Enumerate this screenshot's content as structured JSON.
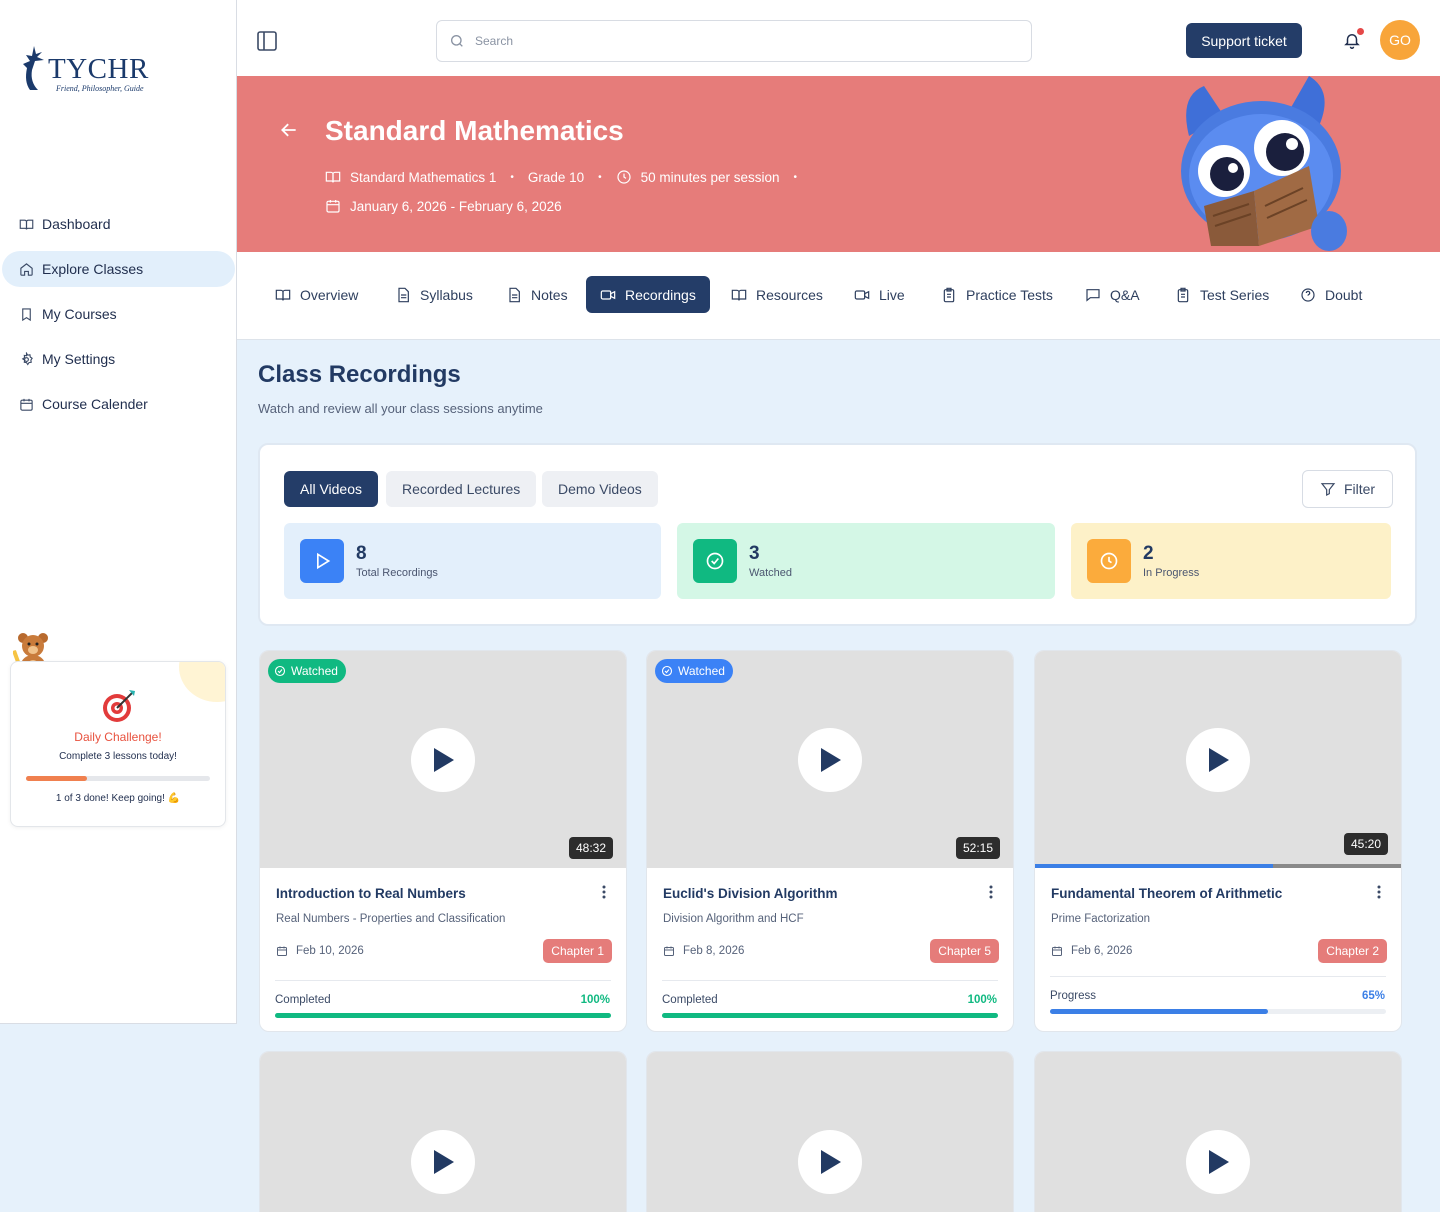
{
  "brand": {
    "name": "TYCHR",
    "tagline": "Friend, Philosopher, Guide"
  },
  "sidebar": {
    "items": [
      {
        "label": "Dashboard",
        "icon": "book-open-icon",
        "active": false
      },
      {
        "label": "Explore Classes",
        "icon": "home-icon",
        "active": true
      },
      {
        "label": "My Courses",
        "icon": "bookmark-icon",
        "active": false
      },
      {
        "label": "My Settings",
        "icon": "gear-icon",
        "active": false
      },
      {
        "label": "Course Calender",
        "icon": "calendar-icon",
        "active": false
      }
    ],
    "challenge": {
      "title": "Daily Challenge!",
      "subtitle": "Complete 3 lessons today!",
      "progress": 0.33,
      "status": "1 of 3 done! Keep going! 💪"
    }
  },
  "topbar": {
    "search_placeholder": "Search",
    "support_label": "Support ticket",
    "avatar_initials": "GO"
  },
  "banner": {
    "title": "Standard Mathematics",
    "course": "Standard Mathematics 1",
    "grade": "Grade 10",
    "session": "50 minutes per session",
    "dates": "January 6, 2026 - February 6, 2026"
  },
  "tabs": [
    {
      "label": "Overview",
      "icon": "book-open-icon"
    },
    {
      "label": "Syllabus",
      "icon": "document-icon"
    },
    {
      "label": "Notes",
      "icon": "document-icon"
    },
    {
      "label": "Recordings",
      "icon": "video-icon",
      "active": true
    },
    {
      "label": "Resources",
      "icon": "book-open-icon"
    },
    {
      "label": "Live",
      "icon": "video-icon"
    },
    {
      "label": "Practice Tests",
      "icon": "clipboard-icon"
    },
    {
      "label": "Q&A",
      "icon": "chat-icon"
    },
    {
      "label": "Test Series",
      "icon": "clipboard-icon"
    },
    {
      "label": "Doubt",
      "icon": "help-circle-icon"
    }
  ],
  "section": {
    "title": "Class Recordings",
    "subtitle": "Watch and review all your class sessions anytime"
  },
  "filters": {
    "tabs": [
      "All Videos",
      "Recorded Lectures",
      "Demo Videos"
    ],
    "active": "All Videos",
    "filter_label": "Filter"
  },
  "stats": [
    {
      "value": "8",
      "label": "Total Recordings",
      "icon": "play-icon",
      "color": "#3b82f6",
      "bg": "#e3effb"
    },
    {
      "value": "3",
      "label": "Watched",
      "icon": "check-circle-icon",
      "color": "#10b981",
      "bg": "#d4f7e6"
    },
    {
      "value": "2",
      "label": "In Progress",
      "icon": "clock-icon",
      "color": "#fbab3c",
      "bg": "#fdf1c8"
    }
  ],
  "videos": [
    {
      "badge": "Watched",
      "badge_color": "#10b981",
      "duration": "48:32",
      "title": "Introduction to Real Numbers",
      "topic": "Real Numbers - Properties and Classification",
      "date": "Feb 10, 2026",
      "chapter": "Chapter 1",
      "progress_label": "Completed",
      "progress_value": "100%",
      "progress": 1.0,
      "bar_color": "#10b981"
    },
    {
      "badge": "Watched",
      "badge_color": "#3b82f6",
      "duration": "52:15",
      "title": "Euclid's Division Algorithm",
      "topic": "Division Algorithm and HCF",
      "date": "Feb 8, 2026",
      "chapter": "Chapter 5",
      "progress_label": "Completed",
      "progress_value": "100%",
      "progress": 1.0,
      "bar_color": "#10b981"
    },
    {
      "badge": "",
      "duration": "45:20",
      "title": "Fundamental Theorem of Arithmetic",
      "topic": "Prime Factorization",
      "date": "Feb 6, 2026",
      "chapter": "Chapter 2",
      "progress_label": "Progress",
      "progress_value": "65%",
      "progress": 0.65,
      "bar_color": "#3b7fe6"
    }
  ],
  "colors": {
    "primary": "#243d68",
    "banner": "#e67c7a",
    "accent_red": "#e57c7a"
  }
}
